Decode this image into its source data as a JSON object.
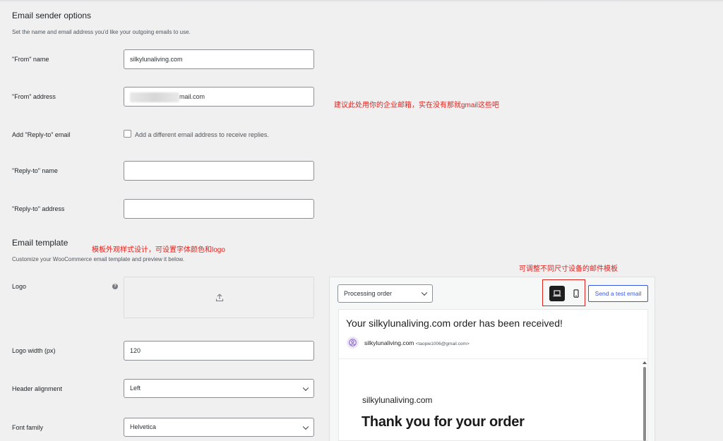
{
  "sender": {
    "title": "Email sender options",
    "description": "Set the name and email address you'd like your outgoing emails to use.",
    "from_name_label": "\"From\" name",
    "from_name_value": "silkylunaliving.com",
    "from_address_label": "\"From\" address",
    "from_address_value": "mail.com",
    "reply_to_label": "Add \"Reply-to\" email",
    "reply_to_checkbox_label": "Add a different email address to receive replies.",
    "reply_to_checked": false,
    "reply_name_label": "\"Reply-to\" name",
    "reply_name_value": "",
    "reply_address_label": "\"Reply-to\" address",
    "reply_address_value": ""
  },
  "template": {
    "title": "Email template",
    "description": "Customize your WooCommerce email template and preview it below.",
    "logo_label": "Logo",
    "logo_width_label": "Logo width (px)",
    "logo_width_value": "120",
    "header_alignment_label": "Header alignment",
    "header_alignment_value": "Left",
    "font_family_label": "Font family",
    "font_family_value": "Helvetica"
  },
  "annotations": {
    "from_address_note": "建议此处用你的企业邮箱，实在没有那就gmail这些吧",
    "template_note": "模板外观样式设计，可设置字体颜色和logo",
    "device_note": "可调整不同尺寸设备的邮件模板",
    "note_color": "#e3211b"
  },
  "preview": {
    "email_type_value": "Processing order",
    "device_active": "desktop",
    "send_test_label": "Send a test email",
    "subject": "Your silkylunaliving.com order has been received!",
    "sender_name": "silkylunaliving.com",
    "sender_email": "<taopie1006@gmail.com>",
    "store_name": "silkylunaliving.com",
    "heading": "Thank you for your order"
  },
  "icons": {
    "upload": "upload-icon",
    "help": "help-icon",
    "desktop": "desktop-icon",
    "mobile": "mobile-icon",
    "avatar": "person-circle-icon"
  },
  "colors": {
    "accent": "#3858e9",
    "background": "#f0f0f1"
  }
}
